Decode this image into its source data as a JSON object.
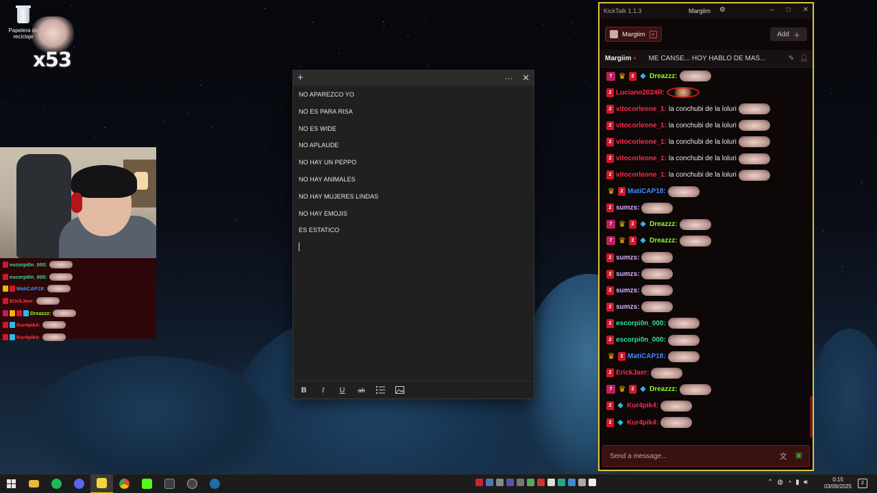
{
  "desktop": {
    "recycle_bin_label": "Papelera de reciclaje",
    "overlay_count": "x53"
  },
  "mini_chat": [
    {
      "user": "escorpi0n_000:",
      "color": "#32e0a0",
      "badges": [
        "sub"
      ]
    },
    {
      "user": "escorpi0n_000:",
      "color": "#32e0a0",
      "badges": [
        "sub"
      ]
    },
    {
      "user": "MatiCAP18:",
      "color": "#3f8cff",
      "badges": [
        "crown",
        "sub"
      ]
    },
    {
      "user": "ErickJaer:",
      "color": "#ff3a3a",
      "badges": [
        "sub"
      ]
    },
    {
      "user": "Dreazzz:",
      "color": "#8aff2a",
      "badges": [
        "gift",
        "crown",
        "sub",
        "cube"
      ]
    },
    {
      "user": "Kur4pik4:",
      "color": "#ff3a3a",
      "badges": [
        "sub",
        "cube"
      ]
    },
    {
      "user": "Kur4pik4:",
      "color": "#ff3a3a",
      "badges": [
        "sub",
        "cube"
      ]
    }
  ],
  "notes": {
    "lines": [
      "NO APAREZCO YO",
      "NO ES PARA RISA",
      "NO ES WIDE",
      "NO APLAUDE",
      "NO HAY UN PEPPO",
      "NO HAY ANIMALES",
      "NO HAY MUJERES LINDAS",
      "NO HAY EMOJIS",
      "ES ESTATICO"
    ],
    "toolbar": {
      "bold": "B",
      "italic": "I",
      "underline": "U",
      "strike": "ab"
    }
  },
  "kicktalk": {
    "app_title": "KickTalk 1.1.3",
    "current_user": "Margiim",
    "tab_label": "Margiim",
    "add_label": "Add",
    "channel_name": "Margiim",
    "stream_title": "ME CANSE... HOY HABLO DE MAS...",
    "input_placeholder": "Send a message...",
    "messages": [
      {
        "user": "Dreazzz:",
        "color": "#8aff2a",
        "badges": [
          "gift",
          "crown",
          "sub",
          "cube"
        ],
        "text": ""
      },
      {
        "user": "Luciano2024R:",
        "color": "#ff2a4a",
        "badges": [
          "sub"
        ],
        "text": "",
        "emote": "ring"
      },
      {
        "user": "vitocorleone_1:",
        "color": "#ff2a4a",
        "badges": [
          "sub"
        ],
        "text": "la conchubi de la loluri"
      },
      {
        "user": "vitocorleone_1:",
        "color": "#ff2a4a",
        "badges": [
          "sub"
        ],
        "text": "la conchubi de la loluri"
      },
      {
        "user": "vitocorleone_1:",
        "color": "#ff2a4a",
        "badges": [
          "sub"
        ],
        "text": "la conchubi de la loluri"
      },
      {
        "user": "vitocorleone_1:",
        "color": "#ff2a4a",
        "badges": [
          "sub"
        ],
        "text": "la conchubi de la loluri"
      },
      {
        "user": "vitocorleone_1:",
        "color": "#ff2a4a",
        "badges": [
          "sub"
        ],
        "text": "la conchubi de la loluri"
      },
      {
        "user": "MatiCAP18:",
        "color": "#3f8cff",
        "badges": [
          "crown",
          "sub"
        ],
        "text": ""
      },
      {
        "user": "sumzs:",
        "color": "#d7b3ff",
        "badges": [
          "sub"
        ],
        "text": ""
      },
      {
        "user": "Dreazzz:",
        "color": "#8aff2a",
        "badges": [
          "gift",
          "crown",
          "sub",
          "cube"
        ],
        "text": ""
      },
      {
        "user": "Dreazzz:",
        "color": "#8aff2a",
        "badges": [
          "gift",
          "crown",
          "sub",
          "cube"
        ],
        "text": ""
      },
      {
        "user": "sumzs:",
        "color": "#d7b3ff",
        "badges": [
          "sub"
        ],
        "text": ""
      },
      {
        "user": "sumzs:",
        "color": "#d7b3ff",
        "badges": [
          "sub"
        ],
        "text": ""
      },
      {
        "user": "sumzs:",
        "color": "#d7b3ff",
        "badges": [
          "sub"
        ],
        "text": ""
      },
      {
        "user": "sumzs:",
        "color": "#d7b3ff",
        "badges": [
          "sub"
        ],
        "text": ""
      },
      {
        "user": "escorpi0n_000:",
        "color": "#32e0a0",
        "badges": [
          "sub"
        ],
        "text": ""
      },
      {
        "user": "escorpi0n_000:",
        "color": "#32e0a0",
        "badges": [
          "sub"
        ],
        "text": ""
      },
      {
        "user": "MatiCAP18:",
        "color": "#3f8cff",
        "badges": [
          "crown",
          "sub"
        ],
        "text": ""
      },
      {
        "user": "ErickJaer:",
        "color": "#ff2a4a",
        "badges": [
          "sub"
        ],
        "text": ""
      },
      {
        "user": "Dreazzz:",
        "color": "#8aff2a",
        "badges": [
          "gift",
          "crown",
          "sub",
          "cube"
        ],
        "text": ""
      },
      {
        "user": "Kur4pik4:",
        "color": "#ff2a4a",
        "badges": [
          "sub",
          "cube"
        ],
        "text": ""
      },
      {
        "user": "Kur4pik4:",
        "color": "#ff2a4a",
        "badges": [
          "sub",
          "cube"
        ],
        "text": ""
      }
    ]
  },
  "taskbar": {
    "time": "0:15",
    "date": "03/09/2025",
    "notification_count": "2",
    "apps": [
      "start-icon",
      "file-explorer-icon",
      "spotify-icon",
      "discord-icon",
      "sticky-notes-icon",
      "chrome-icon",
      "kick-icon",
      "obs-icon",
      "app-icon",
      "steam-icon"
    ]
  }
}
